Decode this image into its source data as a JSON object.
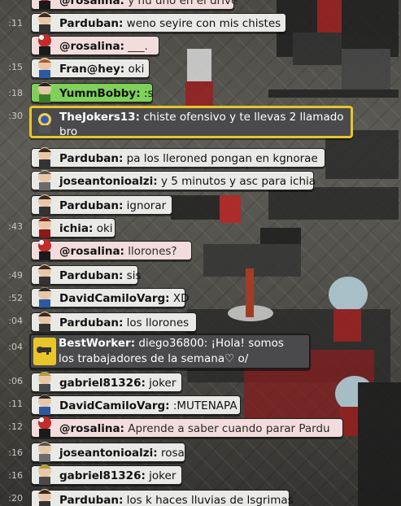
{
  "chat": {
    "messages": [
      {
        "time": "",
        "user": "@rosalina:",
        "text": "y hu uno en el drive",
        "style": "pink"
      },
      {
        "time": ":11",
        "user": "Parduban:",
        "text": "weno seyire con mis chistes",
        "style": "plain"
      },
      {
        "time": "",
        "user": "@rosalina:",
        "text": "___.",
        "style": "pink"
      },
      {
        "time": ":15",
        "user": "Fran@hey:",
        "text": "oki",
        "style": "plain"
      },
      {
        "time": ":18",
        "user": "YummBobby:",
        "text": ":s",
        "style": "green"
      },
      {
        "time": ":30",
        "user": "TheJokers13:",
        "text": "chiste ofensivo y te llevas 2 llamado bro",
        "style": "highlight"
      },
      {
        "time": "",
        "user": "Parduban:",
        "text": "pa los lleroned pongan en kgnorae",
        "style": "plain"
      },
      {
        "time": "",
        "user": "joseantonioalzi:",
        "text": "y 5 minutos y asc para ichia",
        "style": "plain"
      },
      {
        "time": "",
        "user": "Parduban:",
        "text": "ignorar",
        "style": "plain"
      },
      {
        "time": ":43",
        "user": "ichia:",
        "text": "oki",
        "style": "plain"
      },
      {
        "time": "",
        "user": "@rosalina:",
        "text": "llorones?",
        "style": "pink"
      },
      {
        "time": ":49",
        "user": "Parduban:",
        "text": "sis",
        "style": "plain"
      },
      {
        "time": ":52",
        "user": "DavidCamiloVarg:",
        "text": "XD",
        "style": "plain"
      },
      {
        "time": ":04",
        "user": "Parduban:",
        "text": "los llorones",
        "style": "plain"
      },
      {
        "time": ":04",
        "user": "BestWorker:",
        "text": "diego36800: ¡Hola! somos los trabajadores de la semana♡ o/",
        "style": "bestworker"
      },
      {
        "time": ":06",
        "user": "gabriel81326:",
        "text": "joker",
        "style": "plain"
      },
      {
        "time": ":11",
        "user": "DavidCamiloVarg:",
        "text": ":MUTENAPA",
        "style": "plain"
      },
      {
        "time": ":12",
        "user": "@rosalina:",
        "text": "Aprende a saber cuando parar Pardu",
        "style": "pink"
      },
      {
        "time": ":16",
        "user": "joseantonioalzi:",
        "text": "rosa",
        "style": "plain"
      },
      {
        "time": ":16",
        "user": "gabriel81326:",
        "text": "joker",
        "style": "plain"
      },
      {
        "time": ":20",
        "user": "Parduban:",
        "text": "los k haces lluvias de lsgrimas",
        "style": "plain"
      }
    ]
  },
  "colors": {
    "highlight_border": "#e8c62a",
    "pink_bubble": "#f2dcdc",
    "green_bubble": "#7fd15a"
  },
  "icons": {
    "avatar": "user-avatar-icon",
    "worker": "key-badge-icon"
  }
}
